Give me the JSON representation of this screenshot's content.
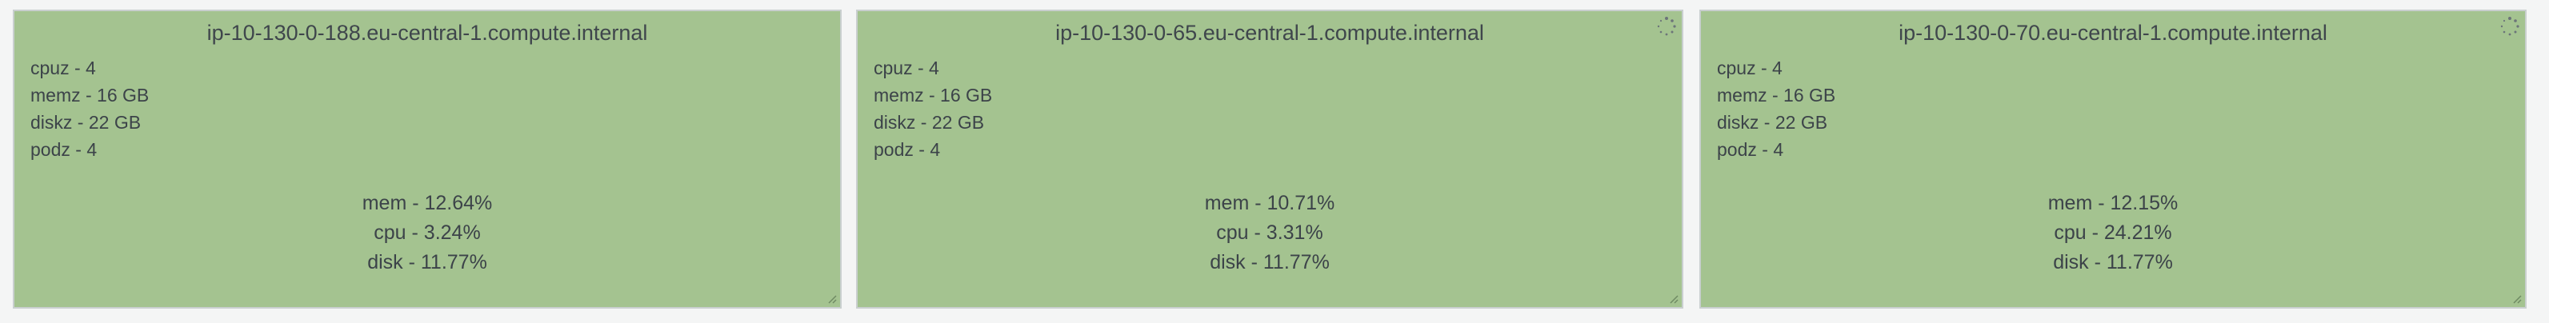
{
  "panels": [
    {
      "title": "ip-10-130-0-188.eu-central-1.compute.internal",
      "specs": [
        "cpuz - 4",
        "memz - 16 GB",
        "diskz - 22 GB",
        "podz - 4"
      ],
      "stats": [
        "mem - 12.64%",
        "cpu - 3.24%",
        "disk - 11.77%"
      ],
      "loading": false
    },
    {
      "title": "ip-10-130-0-65.eu-central-1.compute.internal",
      "specs": [
        "cpuz - 4",
        "memz - 16 GB",
        "diskz - 22 GB",
        "podz - 4"
      ],
      "stats": [
        "mem - 10.71%",
        "cpu - 3.31%",
        "disk - 11.77%"
      ],
      "loading": true
    },
    {
      "title": "ip-10-130-0-70.eu-central-1.compute.internal",
      "specs": [
        "cpuz - 4",
        "memz - 16 GB",
        "diskz - 22 GB",
        "podz - 4"
      ],
      "stats": [
        "mem - 12.15%",
        "cpu - 24.21%",
        "disk - 11.77%"
      ],
      "loading": true
    }
  ],
  "colors": {
    "panel_background": "#a4c390",
    "page_background": "#f4f5f5",
    "text": "#3c4349"
  }
}
